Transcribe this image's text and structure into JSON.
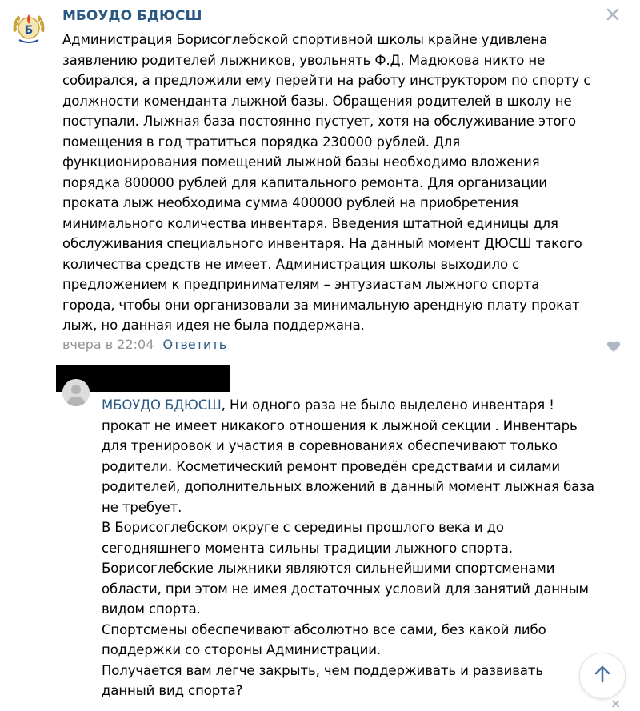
{
  "post": {
    "author": "МБОУДО БДЮСШ",
    "close_icon": "close-icon",
    "text": "Администрация Борисоглебской спортивной школы крайне удивлена\nзаявлению родителей лыжников, увольнять Ф.Д. Мадюкова никто не\nсобирался, а предложили ему перейти на работу инструктором по спорту с\nдолжности коменданта лыжной базы. Обращения родителей в школу не\nпоступали. Лыжная база постоянно пустует, хотя на обслуживание этого\nпомещения в год тратиться порядка 230000 рублей. Для\nфункционирования помещений лыжной базы необходимо вложения\nпорядка 800000 рублей для капитального ремонта. Для организации\nпроката лыж необходима сумма 400000 рублей на приобретения\nминимального количества инвентаря. Введения штатной единицы для\nобслуживания специального инвентаря. На данный момент ДЮСШ такого\nколичества средств не имеет. Администрация школы выходило с\nпредложением к предпринимателям – энтузиастам лыжного спорта\nгорода, чтобы они организовали за минимальную арендную плату прокат\nлыж, но данная идея не была поддержана.",
    "timestamp": "вчера в 22:04",
    "reply_label": "Ответить",
    "like_icon": "heart-icon"
  },
  "reply": {
    "mention": "МБОУДО БДЮСШ",
    "text": ", Ни одного раза не было выделено инвентаря !\nпрокат не имеет никакого отношения к лыжной секции . Инвентарь\nдля тренировок и участия в соревнованиях обеспечивают только\nродители. Косметический ремонт проведён средствами и силами\nродителей, дополнительных вложений в данный момент лыжная база\nне требует.\nВ Борисоглебском округе с середины прошлого века и до\nсегодняшнего момента сильны традиции лыжного спорта.\nБорисоглебские лыжники являются сильнейшими спортсменами\nобласти, при этом не имея достаточных условий для занятий данным\nвидом спорта.\nСпортсмены обеспечивают абсолютно все сами, без какой либо\nподдержки со стороны Администрации.\nПолучается вам легче закрыть, чем поддерживать и развивать\nданный вид спорта?"
  },
  "controls": {
    "scroll_up_icon": "arrow-up-icon",
    "bottom_close": "×"
  },
  "colors": {
    "link": "#2a5885",
    "meta": "#939393",
    "icon_gray": "#aeb7c2"
  }
}
